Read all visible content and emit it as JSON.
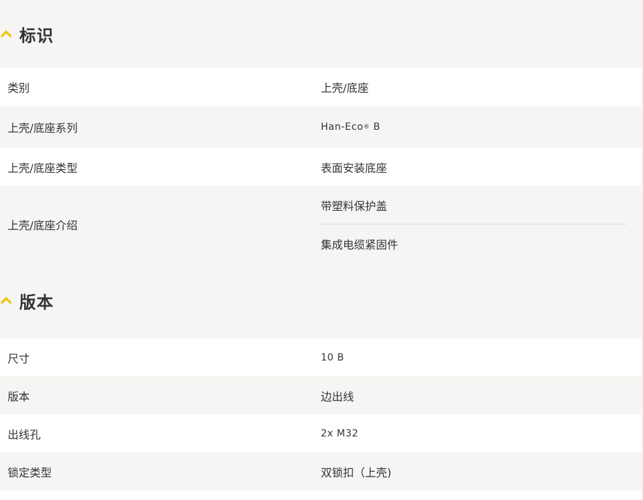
{
  "colors": {
    "accent": "#f2c200",
    "background": "#f6f5f3",
    "row_white": "#ffffff",
    "text": "#333333"
  },
  "sections": [
    {
      "title": "标识",
      "rows": [
        {
          "label": "类别",
          "values": [
            "上壳/底座"
          ]
        },
        {
          "label": "上壳/底座系列",
          "values": [
            "Han-Eco",
            "B"
          ],
          "sup": "®"
        },
        {
          "label": "上壳/底座类型",
          "values": [
            "表面安装底座"
          ]
        },
        {
          "label": "上壳/底座介绍",
          "values": [
            "带塑料保护盖",
            "集成电缆紧固件"
          ]
        }
      ]
    },
    {
      "title": "版本",
      "rows": [
        {
          "label": "尺寸",
          "values": [
            "10 B"
          ]
        },
        {
          "label": "版本",
          "values": [
            "边出线"
          ]
        },
        {
          "label": "出线孔",
          "values": [
            "2x M32"
          ]
        },
        {
          "label": "锁定类型",
          "values": [
            "双锁扣（上壳)"
          ]
        }
      ]
    }
  ]
}
